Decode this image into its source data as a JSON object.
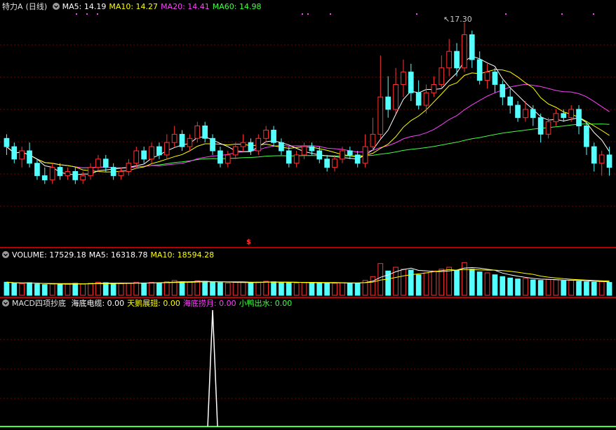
{
  "stock": {
    "name": "特力A",
    "period": "(日线)"
  },
  "price_legend": [
    {
      "label": "MA5:",
      "value": "14.19",
      "color": "#ffffff"
    },
    {
      "label": "MA10:",
      "value": "14.27",
      "color": "#ffff00"
    },
    {
      "label": "MA20:",
      "value": "14.41",
      "color": "#ff40ff"
    },
    {
      "label": "MA60:",
      "value": "14.98",
      "color": "#40ff40"
    }
  ],
  "high_label": "17.30",
  "signal_marker": "$",
  "volume_legend": [
    {
      "label": "VOLUME:",
      "value": "17529.18",
      "color": "#ffffff"
    },
    {
      "label": "MA5:",
      "value": "16318.78",
      "color": "#ffffff"
    },
    {
      "label": "MA10:",
      "value": "18594.28",
      "color": "#ffff00"
    }
  ],
  "macd_legend": {
    "title": "MACD四项抄底",
    "items": [
      {
        "label": "海底电缆:",
        "value": "0.00",
        "color": "#ffffff"
      },
      {
        "label": "天鹅展翅:",
        "value": "0.00",
        "color": "#ffff00"
      },
      {
        "label": "海底捞月:",
        "value": "0.00",
        "color": "#ff40ff"
      },
      {
        "label": "小鸭出水:",
        "value": "0.00",
        "color": "#40ff40"
      }
    ]
  },
  "colors": {
    "up": "#ff3232",
    "down": "#54ffff",
    "grid": "#7a0000",
    "ma5": "#ffffff",
    "ma10": "#ffff00",
    "ma20": "#ff40ff",
    "ma60": "#40ff40"
  },
  "chart_data": {
    "type": "candlestick",
    "price_range": [
      12.0,
      17.5
    ],
    "high": 17.3,
    "candles": [
      [
        14.5,
        14.3,
        14.6,
        14.1
      ],
      [
        14.3,
        14.0,
        14.4,
        13.9
      ],
      [
        14.0,
        14.2,
        14.3,
        13.8
      ],
      [
        14.2,
        13.9,
        14.4,
        13.8
      ],
      [
        13.9,
        13.6,
        14.0,
        13.5
      ],
      [
        13.6,
        13.5,
        13.8,
        13.4
      ],
      [
        13.5,
        13.8,
        13.9,
        13.4
      ],
      [
        13.8,
        13.6,
        13.9,
        13.5
      ],
      [
        13.6,
        13.7,
        13.8,
        13.5
      ],
      [
        13.7,
        13.5,
        13.8,
        13.4
      ],
      [
        13.5,
        13.6,
        13.7,
        13.4
      ],
      [
        13.6,
        13.8,
        13.9,
        13.5
      ],
      [
        13.8,
        14.0,
        14.1,
        13.7
      ],
      [
        14.0,
        13.8,
        14.1,
        13.7
      ],
      [
        13.8,
        13.6,
        13.9,
        13.5
      ],
      [
        13.6,
        13.7,
        13.8,
        13.5
      ],
      [
        13.7,
        13.9,
        14.0,
        13.6
      ],
      [
        13.9,
        14.2,
        14.3,
        13.8
      ],
      [
        14.2,
        14.0,
        14.3,
        13.9
      ],
      [
        14.0,
        14.3,
        14.4,
        13.9
      ],
      [
        14.3,
        14.1,
        14.4,
        14.0
      ],
      [
        14.1,
        14.4,
        14.6,
        14.0
      ],
      [
        14.4,
        14.6,
        14.8,
        14.3
      ],
      [
        14.6,
        14.3,
        14.7,
        14.2
      ],
      [
        14.3,
        14.5,
        14.6,
        14.2
      ],
      [
        14.5,
        14.8,
        14.9,
        14.4
      ],
      [
        14.8,
        14.5,
        14.9,
        14.4
      ],
      [
        14.5,
        14.2,
        14.6,
        14.1
      ],
      [
        14.2,
        13.9,
        14.3,
        13.8
      ],
      [
        13.9,
        14.1,
        14.2,
        13.8
      ],
      [
        14.1,
        14.3,
        14.4,
        14.0
      ],
      [
        14.3,
        14.4,
        14.6,
        14.2
      ],
      [
        14.4,
        14.2,
        14.5,
        14.1
      ],
      [
        14.2,
        14.5,
        14.6,
        14.1
      ],
      [
        14.5,
        14.7,
        14.8,
        14.4
      ],
      [
        14.7,
        14.4,
        14.8,
        14.3
      ],
      [
        14.4,
        14.2,
        14.5,
        14.1
      ],
      [
        14.2,
        13.9,
        14.3,
        13.8
      ],
      [
        13.9,
        14.1,
        14.2,
        13.8
      ],
      [
        14.1,
        14.3,
        14.4,
        14.0
      ],
      [
        14.3,
        14.2,
        14.4,
        14.1
      ],
      [
        14.2,
        14.0,
        14.3,
        13.9
      ],
      [
        14.0,
        13.8,
        14.1,
        13.7
      ],
      [
        13.8,
        14.0,
        14.1,
        13.7
      ],
      [
        14.0,
        14.2,
        14.3,
        13.9
      ],
      [
        14.2,
        14.1,
        14.3,
        14.0
      ],
      [
        14.1,
        13.9,
        14.2,
        13.8
      ],
      [
        13.9,
        14.3,
        14.6,
        13.8
      ],
      [
        14.3,
        14.6,
        15.0,
        14.2
      ],
      [
        14.6,
        15.5,
        16.5,
        14.5
      ],
      [
        15.5,
        15.2,
        16.0,
        15.0
      ],
      [
        15.2,
        15.8,
        16.2,
        15.1
      ],
      [
        15.8,
        16.1,
        16.4,
        15.5
      ],
      [
        16.1,
        15.6,
        16.3,
        15.4
      ],
      [
        15.6,
        15.3,
        15.9,
        15.2
      ],
      [
        15.3,
        15.6,
        15.8,
        15.1
      ],
      [
        15.6,
        15.8,
        16.0,
        15.5
      ],
      [
        15.8,
        16.2,
        16.5,
        15.7
      ],
      [
        16.2,
        16.6,
        16.9,
        16.0
      ],
      [
        16.6,
        16.2,
        16.8,
        16.0
      ],
      [
        16.2,
        17.0,
        17.3,
        16.1
      ],
      [
        17.0,
        16.4,
        17.1,
        16.2
      ],
      [
        16.4,
        15.9,
        16.6,
        15.8
      ],
      [
        15.9,
        16.1,
        16.3,
        15.7
      ],
      [
        16.1,
        15.8,
        16.2,
        15.6
      ],
      [
        15.8,
        15.5,
        15.9,
        15.3
      ],
      [
        15.5,
        15.3,
        15.7,
        15.1
      ],
      [
        15.3,
        15.0,
        15.4,
        14.9
      ],
      [
        15.0,
        15.2,
        15.4,
        14.9
      ],
      [
        15.2,
        15.0,
        15.3,
        14.8
      ],
      [
        15.0,
        14.6,
        15.1,
        14.4
      ],
      [
        14.6,
        14.9,
        15.0,
        14.5
      ],
      [
        14.9,
        15.1,
        15.2,
        14.8
      ],
      [
        15.1,
        15.0,
        15.2,
        14.9
      ],
      [
        15.0,
        15.2,
        15.3,
        14.9
      ],
      [
        15.2,
        14.8,
        15.3,
        14.6
      ],
      [
        14.8,
        14.3,
        14.9,
        14.1
      ],
      [
        14.3,
        13.9,
        14.4,
        13.7
      ],
      [
        13.9,
        14.1,
        14.2,
        13.6
      ],
      [
        14.1,
        13.8,
        14.3,
        13.6
      ]
    ],
    "volume_range": [
      0,
      36000
    ],
    "volumes": [
      14000,
      13000,
      12500,
      13500,
      12000,
      11500,
      12000,
      11800,
      12200,
      12800,
      12000,
      13000,
      14000,
      13500,
      12800,
      12500,
      13000,
      14000,
      13200,
      13800,
      13500,
      14500,
      16000,
      14500,
      14000,
      15500,
      15000,
      14000,
      13500,
      13200,
      13800,
      14200,
      13500,
      14000,
      15000,
      14500,
      13800,
      13500,
      13200,
      13500,
      13800,
      13200,
      12800,
      13000,
      13500,
      13200,
      13000,
      16000,
      20000,
      34000,
      26000,
      30000,
      28000,
      27000,
      22000,
      24000,
      26000,
      28000,
      30000,
      27000,
      35000,
      28000,
      25000,
      24000,
      22000,
      20000,
      18500,
      17500,
      18000,
      16500,
      16000,
      17000,
      16500,
      15500,
      16000,
      15000,
      14500,
      14000,
      14500,
      13800
    ],
    "macd_signal": {
      "index": 27,
      "peak": 1.0
    }
  }
}
